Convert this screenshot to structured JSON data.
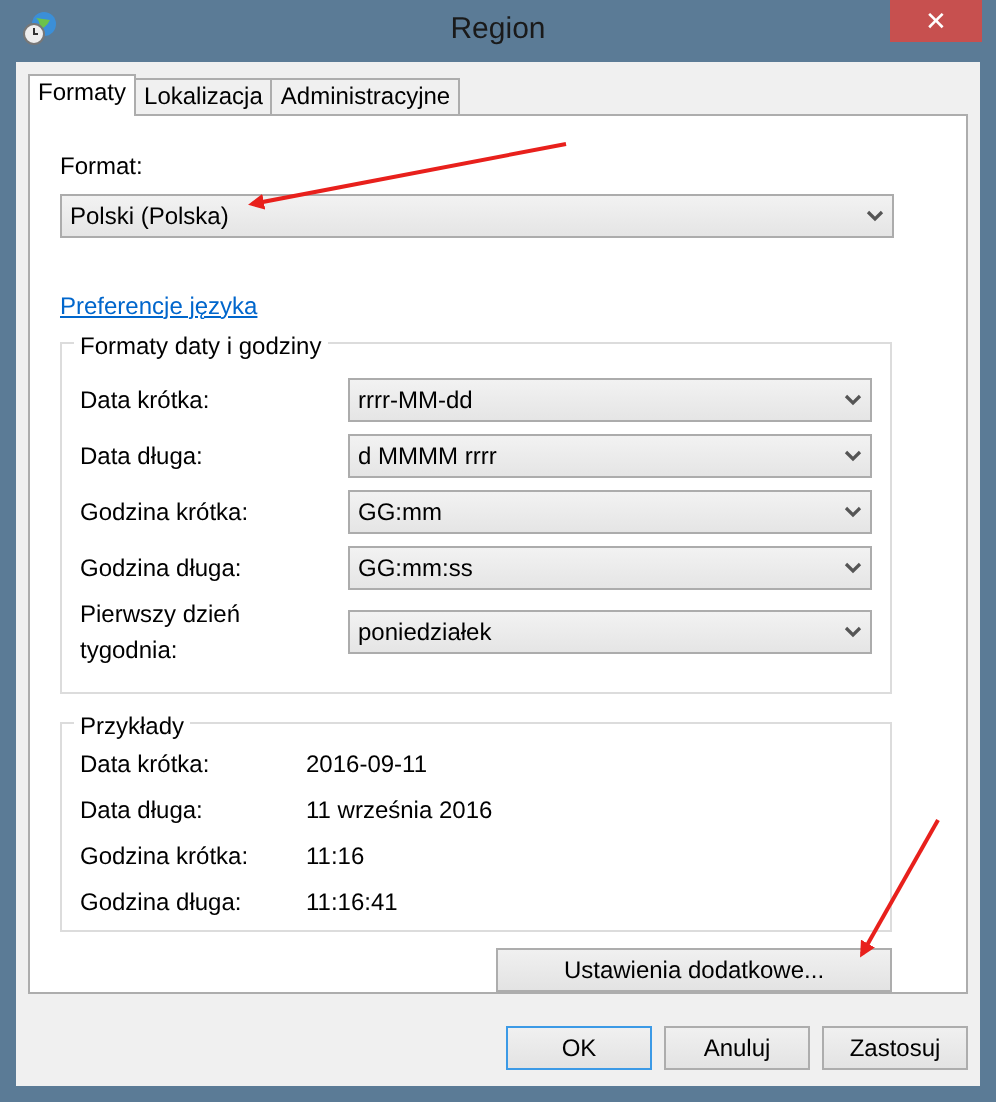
{
  "window": {
    "title": "Region",
    "close": "✕"
  },
  "tabs": [
    {
      "label": "Formaty",
      "selected": true
    },
    {
      "label": "Lokalizacja",
      "selected": false
    },
    {
      "label": "Administracyjne",
      "selected": false
    }
  ],
  "format": {
    "label": "Format:",
    "value": "Polski (Polska)"
  },
  "link": "Preferencje języka",
  "formats_group": {
    "title": "Formaty daty i godziny",
    "rows": [
      {
        "label": "Data krótka:",
        "value": "rrrr-MM-dd"
      },
      {
        "label": "Data długa:",
        "value": "d MMMM rrrr"
      },
      {
        "label": "Godzina krótka:",
        "value": "GG:mm"
      },
      {
        "label": "Godzina długa:",
        "value": "GG:mm:ss"
      },
      {
        "label": "Pierwszy dzień tygodnia:",
        "value": "poniedziałek"
      }
    ]
  },
  "examples_group": {
    "title": "Przykłady",
    "rows": [
      {
        "label": "Data krótka:",
        "value": "2016-09-11"
      },
      {
        "label": "Data długa:",
        "value": "11 września 2016"
      },
      {
        "label": "Godzina krótka:",
        "value": "11:16"
      },
      {
        "label": "Godzina długa:",
        "value": "11:16:41"
      }
    ]
  },
  "additional_button": "Ustawienia dodatkowe...",
  "buttons": [
    {
      "label": "OK",
      "default": true
    },
    {
      "label": "Anuluj",
      "default": false
    },
    {
      "label": "Zastosuj",
      "default": false
    }
  ]
}
